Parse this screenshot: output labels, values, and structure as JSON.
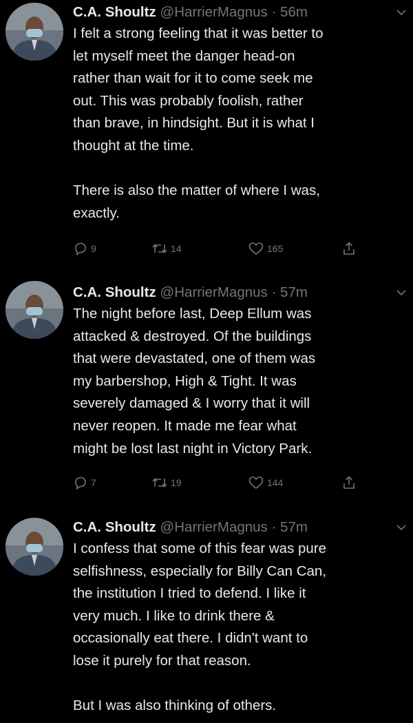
{
  "tweets": [
    {
      "author_name": "C.A. Shoultz",
      "handle": "@HarrierMagnus",
      "separator": "·",
      "time": "56m",
      "text": "I felt a strong feeling that it was better to\nlet myself meet the danger head-on\nrather than wait for it to come seek me\nout.  This was probably foolish, rather\nthan brave, in hindsight.  But it is what I\nthought at the time.\n\nThere is also the matter of where I was,\nexactly.",
      "replies": "9",
      "retweets": "14",
      "likes": "165"
    },
    {
      "author_name": "C.A. Shoultz",
      "handle": "@HarrierMagnus",
      "separator": "·",
      "time": "57m",
      "text": "The night before last, Deep Ellum was\nattacked & destroyed.  Of the buildings\nthat were devastated, one of them was\nmy barbershop, High & Tight.  It was\nseverely damaged & I worry that it will\nnever reopen.  It made me fear what\nmight be lost last night in Victory Park.",
      "replies": "7",
      "retweets": "19",
      "likes": "144"
    },
    {
      "author_name": "C.A. Shoultz",
      "handle": "@HarrierMagnus",
      "separator": "·",
      "time": "57m",
      "text": "I confess that some of this fear was pure\nselfishness, especially for Billy Can Can,\nthe institution I tried to defend.  I like it\nvery much.  I like to drink there &\noccasionally eat there.  I didn't want to\nlose it purely for that reason.\n\nBut I was also thinking of others."
    }
  ],
  "icons": {
    "reply": "reply-icon",
    "retweet": "retweet-icon",
    "like": "heart-icon",
    "share": "share-icon",
    "menu": "chevron-down-icon"
  },
  "colors": {
    "background": "#000000",
    "text": "#e7e9ea",
    "secondary": "#71767b"
  }
}
